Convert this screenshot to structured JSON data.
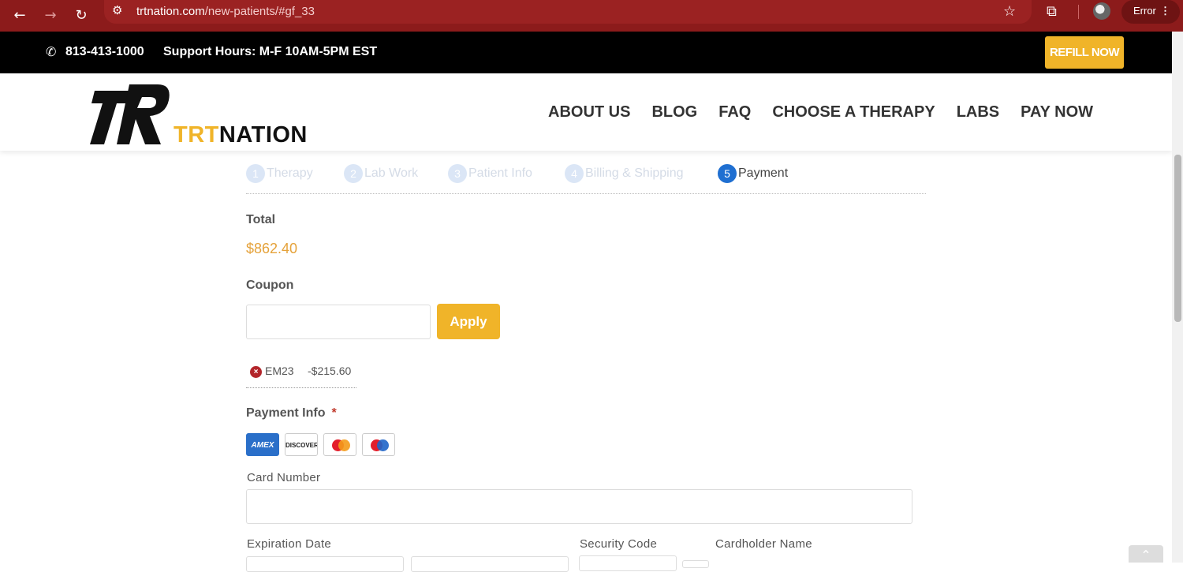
{
  "browser": {
    "url_host": "trtnation.com",
    "url_path": "/new-patients/#gf_33",
    "error_label": "Error"
  },
  "topbar": {
    "phone": "813-413-1000",
    "support": "Support Hours: M-F 10AM-5PM EST",
    "refill_label": "REFILL NOW"
  },
  "logo": {
    "brand_a": "TRT",
    "brand_b": "NATION"
  },
  "nav": [
    "ABOUT US",
    "BLOG",
    "FAQ",
    "CHOOSE A THERAPY",
    "LABS",
    "PAY NOW"
  ],
  "steps": [
    {
      "num": "1",
      "label": "Therapy"
    },
    {
      "num": "2",
      "label": "Lab Work"
    },
    {
      "num": "3",
      "label": "Patient Info"
    },
    {
      "num": "4",
      "label": "Billing & Shipping"
    },
    {
      "num": "5",
      "label": "Payment"
    }
  ],
  "form": {
    "total_label": "Total",
    "total_value": "$862.40",
    "coupon_label": "Coupon",
    "coupon_value": "",
    "apply_label": "Apply",
    "coupon_code": "EM23",
    "coupon_amount": "-$215.60",
    "payment_label": "Payment Info",
    "required_mark": "*",
    "cards": {
      "amex": "AMEX",
      "discover": "DISCOVER"
    },
    "card_number_label": "Card Number",
    "expiration_label": "Expiration Date",
    "security_label": "Security Code",
    "cardholder_label": "Cardholder Name"
  },
  "colors": {
    "accent": "#f0b429",
    "browser": "#8c1b1b",
    "step_active": "#1f6fd1"
  }
}
